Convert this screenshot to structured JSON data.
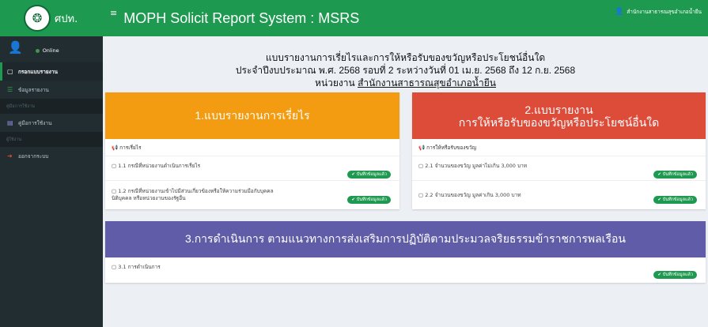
{
  "brand": {
    "emblem_icon": "royal-emblem-icon",
    "short_name": "ศปท."
  },
  "header": {
    "menu_icon": "≡",
    "title": "MOPH Solicit Report System : MSRS",
    "agency": "สำนักงานสาธารณสุขอำเภอน้ำยืน"
  },
  "sidebar": {
    "status": "Online",
    "items": [
      {
        "label": "กรอกแบบรายงาน",
        "icon": "file-icon",
        "glyph": "▢",
        "active": true
      },
      {
        "label": "ข้อมูลรายงาน",
        "icon": "list-icon",
        "glyph": "☰"
      }
    ],
    "manual_header": "คู่มือการใช้งาน",
    "manual_item": {
      "label": "คู่มือการใช้งาน",
      "icon": "book-icon",
      "glyph": "▤"
    },
    "users_header": "ผู้ใช้งาน",
    "logout_item": {
      "label": "ออกจากระบบ",
      "icon": "sign-out-icon",
      "glyph": "➜"
    }
  },
  "report": {
    "line1": "แบบรายงานการเรี่ยไรและการให้หรือรับของขวัญหรือประโยชน์อื่นใด",
    "line2": "ประจำปีงบประมาณ พ.ศ. 2568 รอบที่ 2 ระหว่างวันที่ 01 เม.ย. 2568 ถึง 12 ก.ย. 2568",
    "line3_prefix": "หน่วยงาน ",
    "agency": "สำนักงานสาธารณสุขอำเภอน้ำยืน"
  },
  "sections": {
    "s1": {
      "title": "1.แบบรายงานการเรี่ยไร",
      "subheading": "📢 การเรี่ยไร",
      "items": [
        {
          "text": "1.1 กรณีที่หน่วยงานดำเนินการเรี่ยไร",
          "badge": "✔ บันทึกข้อมูลแล้ว"
        },
        {
          "text": "1.2 กรณีที่หน่วยงานเข้าไปมีส่วนเกี่ยวข้องหรือให้ความร่วมมือกับบุคคล นิติบุคคล หรือหน่วยงานของรัฐอื่น",
          "badge": "✔ บันทึกข้อมูลแล้ว"
        }
      ]
    },
    "s2": {
      "title_line1": "2.แบบรายงาน",
      "title_line2": "การให้หรือรับของขวัญหรือประโยชน์อื่นใด",
      "subheading": "📢 การให้หรือรับของขวัญ",
      "items": [
        {
          "text": "2.1 จำนวนของขวัญ มูลค่าไม่เกิน 3,000 บาท",
          "badge": "✔ บันทึกข้อมูลแล้ว"
        },
        {
          "text": "2.2 จำนวนของขวัญ มูลค่าเกิน 3,000 บาท",
          "badge": "✔ บันทึกข้อมูลแล้ว"
        }
      ]
    },
    "s3": {
      "title": "3.การดำเนินการ ตามแนวทางการส่งเสริมการปฏิบัติตามประมวลจริยธรรมข้าราชการพลเรือน",
      "items": [
        {
          "text": "3.1 การดำเนินการ",
          "badge": "✔ บันทึกข้อมูลแล้ว"
        }
      ]
    }
  },
  "colors": {
    "green": "#1e9950",
    "orange": "#f39c12",
    "red": "#dd4b39",
    "purple": "#605ca8",
    "sidebar": "#222d32"
  }
}
